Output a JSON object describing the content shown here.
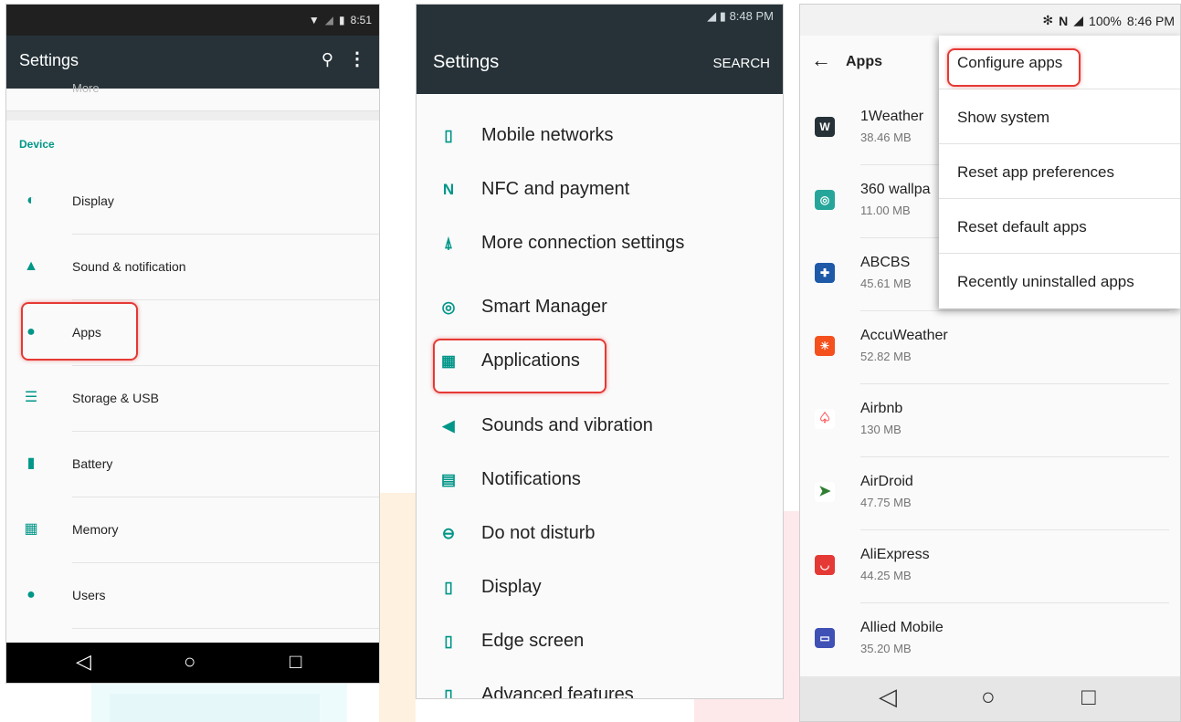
{
  "phone1": {
    "status": {
      "time": "8:51"
    },
    "toolbar": {
      "title": "Settings"
    },
    "partial_item": "More",
    "section_label": "Device",
    "items": [
      {
        "label": "Display",
        "icon": "display-icon"
      },
      {
        "label": "Sound & notification",
        "icon": "bell-icon"
      },
      {
        "label": "Apps",
        "icon": "android-icon"
      },
      {
        "label": "Storage & USB",
        "icon": "storage-icon"
      },
      {
        "label": "Battery",
        "icon": "battery-icon"
      },
      {
        "label": "Memory",
        "icon": "memory-icon"
      },
      {
        "label": "Users",
        "icon": "user-icon"
      }
    ]
  },
  "phone2": {
    "status": {
      "time": "8:48 PM"
    },
    "toolbar": {
      "title": "Settings",
      "action": "SEARCH"
    },
    "items": [
      {
        "label": "Mobile networks",
        "icon": "mobile-network-icon"
      },
      {
        "label": "NFC and payment",
        "icon": "nfc-icon"
      },
      {
        "label": "More connection settings",
        "icon": "connection-icon"
      },
      {
        "label": "Smart Manager",
        "icon": "smart-manager-icon"
      },
      {
        "label": "Applications",
        "icon": "apps-grid-icon"
      },
      {
        "label": "Sounds and vibration",
        "icon": "speaker-icon"
      },
      {
        "label": "Notifications",
        "icon": "notification-icon"
      },
      {
        "label": "Do not disturb",
        "icon": "do-not-disturb-icon"
      },
      {
        "label": "Display",
        "icon": "display-icon"
      },
      {
        "label": "Edge screen",
        "icon": "edge-screen-icon"
      },
      {
        "label": "Advanced features",
        "icon": "advanced-icon"
      }
    ]
  },
  "phone3": {
    "status": {
      "battery": "100%",
      "time": "8:46 PM"
    },
    "appbar": {
      "title": "Apps"
    },
    "apps": [
      {
        "name": "1Weather",
        "size": "38.46 MB",
        "color": "#263238"
      },
      {
        "name": "360 wallpa",
        "size": "11.00 MB",
        "color": "#26a69a"
      },
      {
        "name": "ABCBS",
        "size": "45.61 MB",
        "color": "#1e5aa8"
      },
      {
        "name": "AccuWeather",
        "size": "52.82 MB",
        "color": "#f4511e"
      },
      {
        "name": "Airbnb",
        "size": "130 MB",
        "color": "#ff5a5f"
      },
      {
        "name": "AirDroid",
        "size": "47.75 MB",
        "color": "#2e7d32"
      },
      {
        "name": "AliExpress",
        "size": "44.25 MB",
        "color": "#e53935"
      },
      {
        "name": "Allied Mobile",
        "size": "35.20 MB",
        "color": "#3f51b5"
      }
    ],
    "menu": [
      "Configure apps",
      "Show system",
      "Reset app preferences",
      "Reset default apps",
      "Recently uninstalled apps"
    ]
  },
  "highlight_color": "#e53935"
}
